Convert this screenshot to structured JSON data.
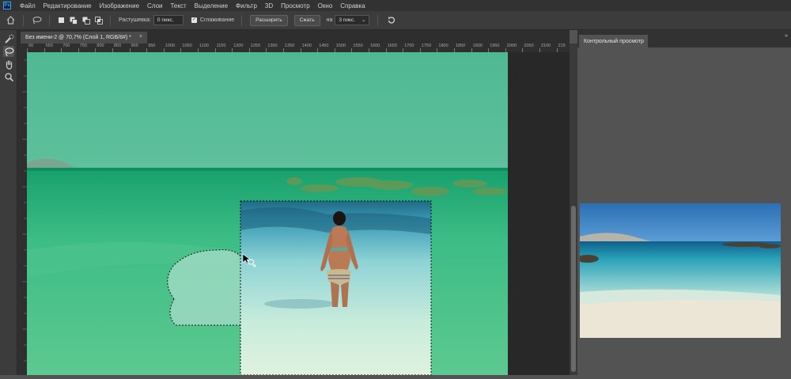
{
  "menubar": {
    "logo": "Ps",
    "items": [
      "Файл",
      "Редактирование",
      "Изображение",
      "Слои",
      "Текст",
      "Выделение",
      "Фильтр",
      "3D",
      "Просмотр",
      "Окно",
      "Справка"
    ]
  },
  "options": {
    "feather_label": "Растушевка:",
    "feather_value": "0 пикс.",
    "antialias_label": "Сглаживание",
    "antialias_checked": true,
    "expand_label": "Расширить",
    "contract_label": "Сжать",
    "by_label": "на",
    "by_value": "3 пикс."
  },
  "document": {
    "tab_title": "Без имени-2 @ 70,7% (Слой 1, RGB/8#) *",
    "close_glyph": "×"
  },
  "ruler_ticks": [
    "00",
    "650",
    "700",
    "750",
    "800",
    "850",
    "900",
    "950",
    "1000",
    "1050",
    "1100",
    "1150",
    "1200",
    "1250",
    "1300",
    "1350",
    "1400",
    "1450",
    "1500",
    "1550",
    "1600",
    "1650",
    "1700",
    "1750",
    "1800",
    "1850",
    "1900",
    "1950",
    "2000",
    "2050",
    "2100",
    "215"
  ],
  "panel": {
    "tab_title": "Контрольный просмотр"
  },
  "tools": [
    "quick-selection-icon",
    "lasso-icon",
    "hand-icon",
    "zoom-icon"
  ],
  "colors": {
    "accent": "#31a8ff",
    "chrome_dark": "#323232",
    "chrome_mid": "#3c3c3c",
    "panel_bg": "#535353"
  }
}
